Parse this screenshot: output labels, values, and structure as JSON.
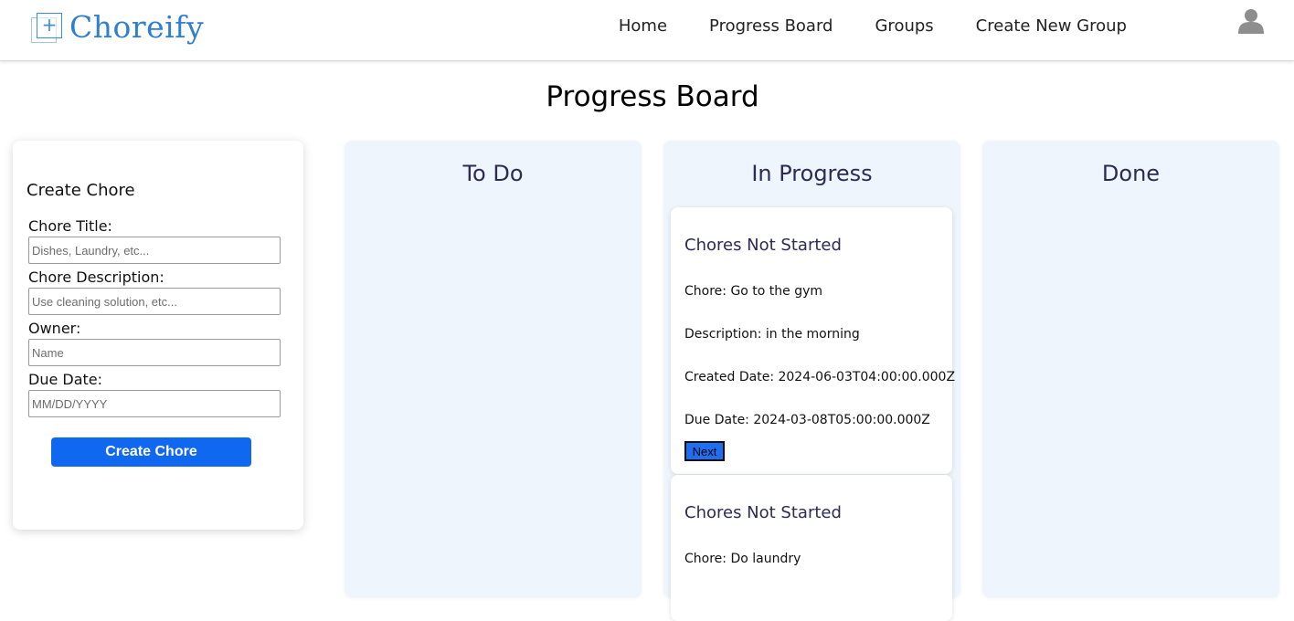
{
  "brand": {
    "name": "Choreify",
    "icon": "plus-square-logo",
    "color": "#2d7fd3"
  },
  "nav": {
    "items": [
      {
        "label": "Home"
      },
      {
        "label": "Progress Board"
      },
      {
        "label": "Groups"
      },
      {
        "label": "Create New Group"
      }
    ],
    "avatar_icon": "user-avatar-icon"
  },
  "page": {
    "title": "Progress Board"
  },
  "form": {
    "heading": "Create Chore",
    "fields": [
      {
        "label": "Chore Title:",
        "placeholder": "Dishes, Laundry, etc...",
        "value": ""
      },
      {
        "label": "Chore Description:",
        "placeholder": "Use cleaning solution, etc...",
        "value": ""
      },
      {
        "label": "Owner:",
        "placeholder": "Name",
        "value": ""
      },
      {
        "label": "Due Date:",
        "placeholder": "MM/DD/YYYY",
        "value": ""
      }
    ],
    "submit_label": "Create Chore",
    "accent_color": "#1168f0"
  },
  "columns": [
    {
      "title": "To Do",
      "cards": []
    },
    {
      "title": "In Progress",
      "cards": [
        {
          "heading": "Chores Not Started",
          "chore": "Chore: Go to the gym",
          "description": "Description: in the morning",
          "created": "Created Date: 2024-06-03T04:00:00.000Z",
          "due": "Due Date: 2024-03-08T05:00:00.000Z",
          "button_label": "Next"
        },
        {
          "heading": "Chores Not Started",
          "chore": "Chore: Do laundry"
        }
      ]
    },
    {
      "title": "Done",
      "cards": []
    }
  ],
  "colors": {
    "column_background": "#eef5fd",
    "heading_text": "#2d2a55"
  }
}
